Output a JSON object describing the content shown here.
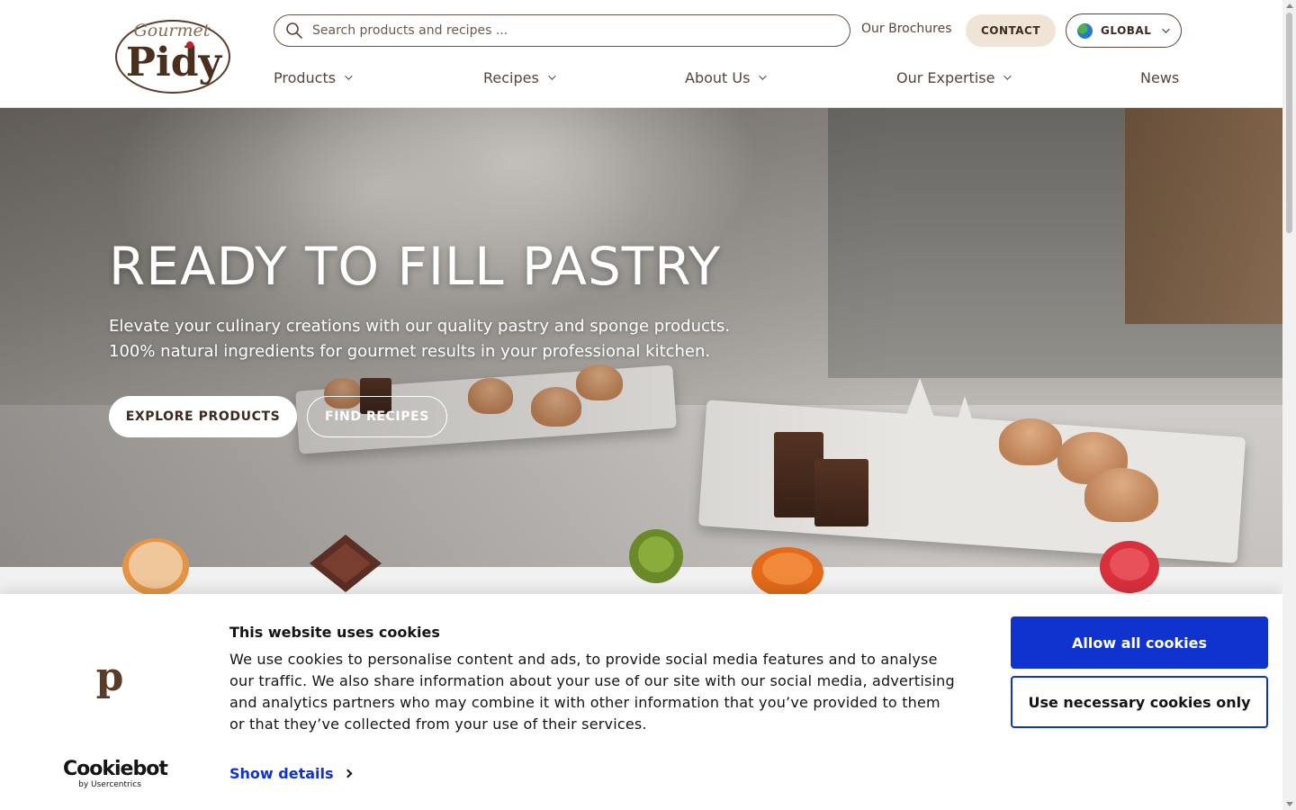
{
  "header": {
    "logo": {
      "top_word": "Gourmet",
      "main_word": "Pidy"
    },
    "search": {
      "placeholder": "Search products and recipes ..."
    },
    "brochures_label": "Our Brochures",
    "contact_label": "CONTACT",
    "region_label": "GLOBAL",
    "nav": [
      {
        "label": "Products",
        "has_dropdown": true
      },
      {
        "label": "Recipes",
        "has_dropdown": true
      },
      {
        "label": "About Us",
        "has_dropdown": true
      },
      {
        "label": "Our Expertise",
        "has_dropdown": true
      },
      {
        "label": "News",
        "has_dropdown": false
      }
    ]
  },
  "hero": {
    "title": "READY TO FILL PASTRY",
    "subtitle_line1": "Elevate your culinary creations with our quality pastry and sponge products.",
    "subtitle_line2": "100% natural ingredients for gourmet results in your professional kitchen.",
    "explore_label": "EXPLORE PRODUCTS",
    "recipes_label": "FIND RECIPES"
  },
  "cookie_banner": {
    "brand_mark": "p",
    "title": "This website uses cookies",
    "text": "We use cookies to personalise content and ads, to provide social media features and to analyse our traffic. We also share information about your use of our site with our social media, advertising and analytics partners who may combine it with other information that you’ve provided to them or that they’ve collected from your use of their services.",
    "show_details_label": "Show details",
    "allow_all_label": "Allow all cookies",
    "necessary_only_label": "Use necessary cookies only",
    "provider": {
      "name": "Cookiebot",
      "byline": "by Usercentrics"
    }
  },
  "colors": {
    "brand_brown": "#5a3b28",
    "contact_bg": "#f0e4d6",
    "cookie_accent": "#1032cf"
  }
}
